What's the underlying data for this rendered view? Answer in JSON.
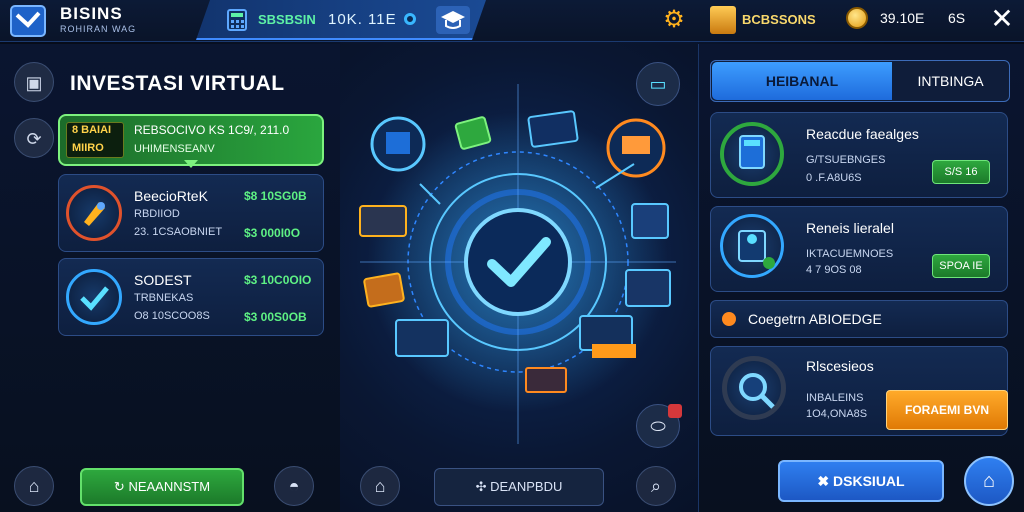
{
  "topbar": {
    "brand": "BISINS",
    "brand_sub": "ROHIRAN WAG",
    "status_text": "SBSBSIN",
    "status_num": "10K. 11E",
    "ledger_text": "BCBSSONS",
    "coin_value": "39.10E",
    "coin_value2": "6S"
  },
  "left": {
    "heading": "INVESTASI VIRTUAL",
    "card1": {
      "badge_line1": "8 BAIAI",
      "badge_line2": "MIIRO",
      "title": "REBSOCIVO KS 1C9/, 211.0",
      "subtitle": "UHIMENSEANV"
    },
    "card2": {
      "title": "BeecioRteK",
      "sub1": "RBDIIOD",
      "sub2": "23. 1CSAOBNIET",
      "val1": "$8 10SG0B",
      "val2": "$3 000I0O"
    },
    "card3": {
      "title": "SODEST",
      "sub1": "TRBNEKAS",
      "sub2": "O8 10SCOO8S",
      "val1": "$3 10C0OIO",
      "val2": "$3 00S0OB"
    },
    "green_button": "NEAANNSTM"
  },
  "middle": {
    "button": "DEANPBDU"
  },
  "right": {
    "tab1": "HEIBANAL",
    "tab2": "INTBINGA",
    "card1": {
      "title": "Reacdue faealges",
      "sub1": "G/TSUEBNGES",
      "sub2": "0 .F.A8U6S",
      "button": "S/S 16"
    },
    "card2": {
      "title": "Reneis lieralel",
      "sub1": "IKTACUEMNOES",
      "sub2": "4 7 9OS 08",
      "button": "SPOA IE"
    },
    "card3": {
      "title": "Coegetrn ABIOEDGE"
    },
    "card4": {
      "title": "Rlscesieos",
      "sub1": "INBALEINS",
      "sub2": "1O4,ONA8S",
      "button": "FORAEMI BVN"
    },
    "blue_button": "DSKSIUAL"
  },
  "colors": {
    "accent_blue": "#2f7ff0",
    "accent_green": "#2ea83e",
    "accent_orange": "#ff9a1a",
    "gold": "#ffc94a"
  }
}
